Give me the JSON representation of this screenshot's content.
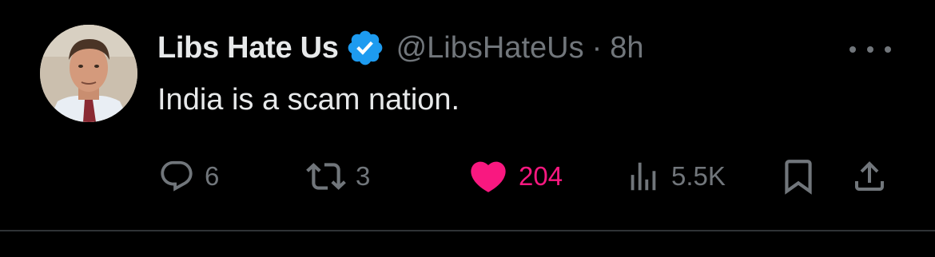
{
  "colors": {
    "background": "#000000",
    "primary_text": "#e7e9ea",
    "secondary_text": "#71767b",
    "verified_blue": "#1d9bf0",
    "like_pink": "#f91880",
    "divider": "#2f3336"
  },
  "tweet": {
    "author": {
      "display_name": "Libs Hate Us",
      "handle": "@LibsHateUs",
      "verified_icon": "verified-badge-icon",
      "avatar": "avatar-photo"
    },
    "separator": "·",
    "time": "8h",
    "text": "India is a scam nation.",
    "more_icon": "more-options-icon",
    "actions": {
      "reply": {
        "icon": "reply-icon",
        "count": "6"
      },
      "retweet": {
        "icon": "retweet-icon",
        "count": "3"
      },
      "like": {
        "icon": "heart-filled-icon",
        "count": "204",
        "active": true
      },
      "views": {
        "icon": "views-icon",
        "count": "5.5K"
      },
      "bookmark": {
        "icon": "bookmark-icon"
      },
      "share": {
        "icon": "share-icon"
      }
    }
  }
}
